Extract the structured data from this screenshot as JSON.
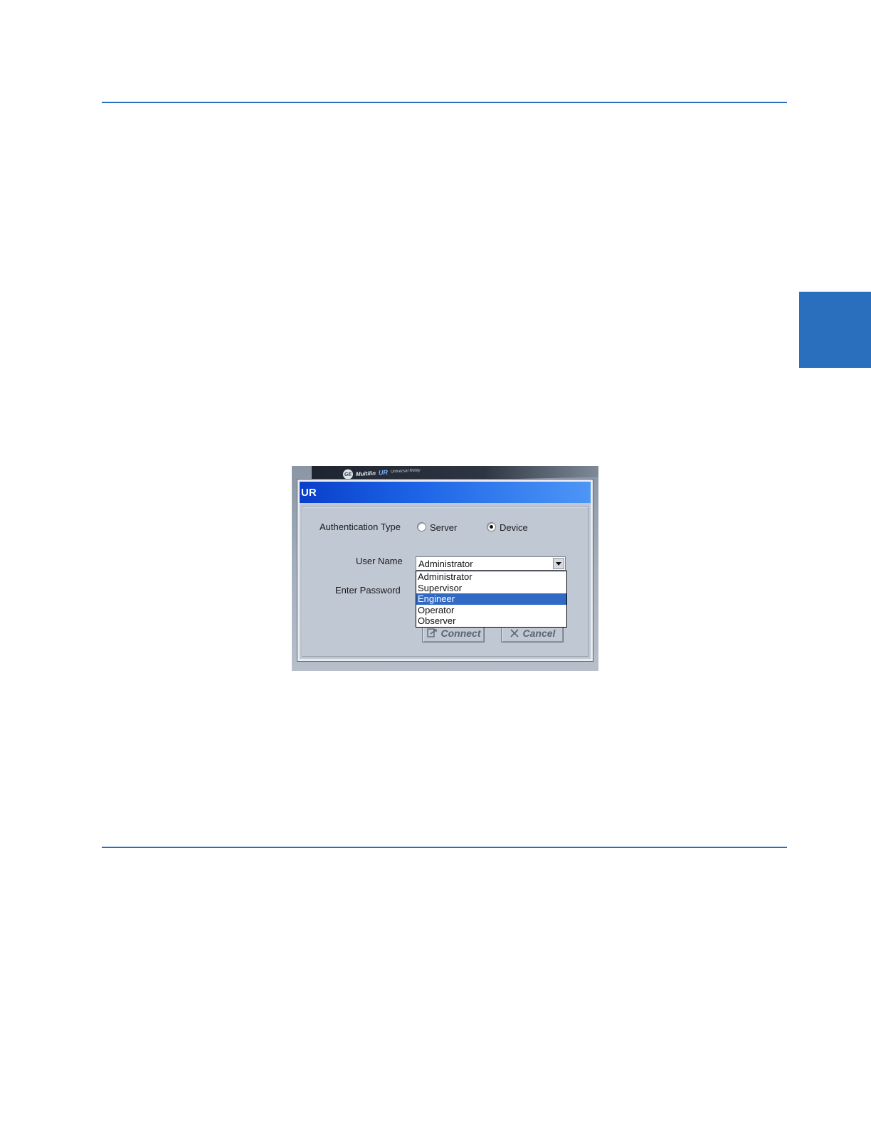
{
  "window": {
    "title": "UR"
  },
  "background": {
    "brand": "Multilin",
    "product": "UR",
    "tagline": "Universal Relay"
  },
  "auth": {
    "label": "Authentication Type",
    "options": [
      "Server",
      "Device"
    ],
    "selected": "Device"
  },
  "user": {
    "label": "User Name",
    "value": "Administrator",
    "options": [
      "Administrator",
      "Supervisor",
      "Engineer",
      "Operator",
      "Observer"
    ],
    "highlighted": "Engineer"
  },
  "password": {
    "label": "Enter Password"
  },
  "buttons": {
    "connect": "Connect",
    "cancel": "Cancel"
  },
  "colors": {
    "accent": "#2a6fbd",
    "titlebar": "#1c64e6",
    "selection": "#316ac5"
  }
}
